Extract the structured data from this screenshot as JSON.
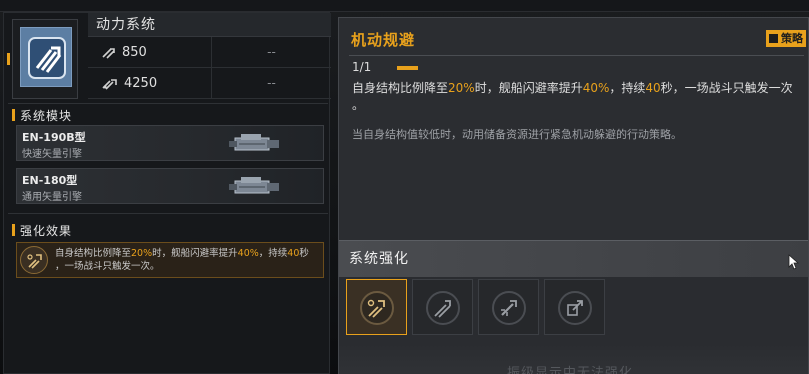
{
  "left_panel": {
    "module_name": "动力系统",
    "stats": [
      {
        "icon": "thrust-icon",
        "value": "850",
        "extra": "--"
      },
      {
        "icon": "speed-icon",
        "value": "4250",
        "extra": "--"
      }
    ],
    "modules_heading": "系统模块",
    "engines": [
      {
        "name": "EN-190B型",
        "desc": "快速矢量引擎"
      },
      {
        "name": "EN-180型",
        "desc": "通用矢量引擎"
      }
    ],
    "effect_heading": "强化效果",
    "effect": {
      "part1": "自身结构比例降至",
      "v1": "20%",
      "part2": "时，舰船闪避率提升",
      "v2": "40%",
      "part3": "，持续",
      "v3": "40",
      "part4": "秒",
      "part5": "，一场战斗只触发一次。"
    }
  },
  "right_panel": {
    "title": "机动规避",
    "strategy_label": "策略",
    "level": "1/1",
    "desc": {
      "part1": "自身结构比例降至",
      "v1": "20%",
      "part2": "时，舰船闪避率提升",
      "v2": "40%",
      "part3": "，持续",
      "v3": "40",
      "part4": "秒，一场战斗只触发一次",
      "part5": "。"
    },
    "sub": "当自身结构值较低时，动用储备资源进行紧急机动躲避的行动策略。",
    "enhance_heading": "系统强化",
    "slots": [
      {
        "icon": "evade-icon",
        "active": true
      },
      {
        "icon": "jet-icon",
        "active": false
      },
      {
        "icon": "boost-icon",
        "active": false
      },
      {
        "icon": "shield-jet-icon",
        "active": false
      }
    ],
    "bottom_hint": "振级显示中无法强化"
  },
  "colors": {
    "accent": "#e8a11c",
    "icon_blue": "#5c7ea3"
  }
}
